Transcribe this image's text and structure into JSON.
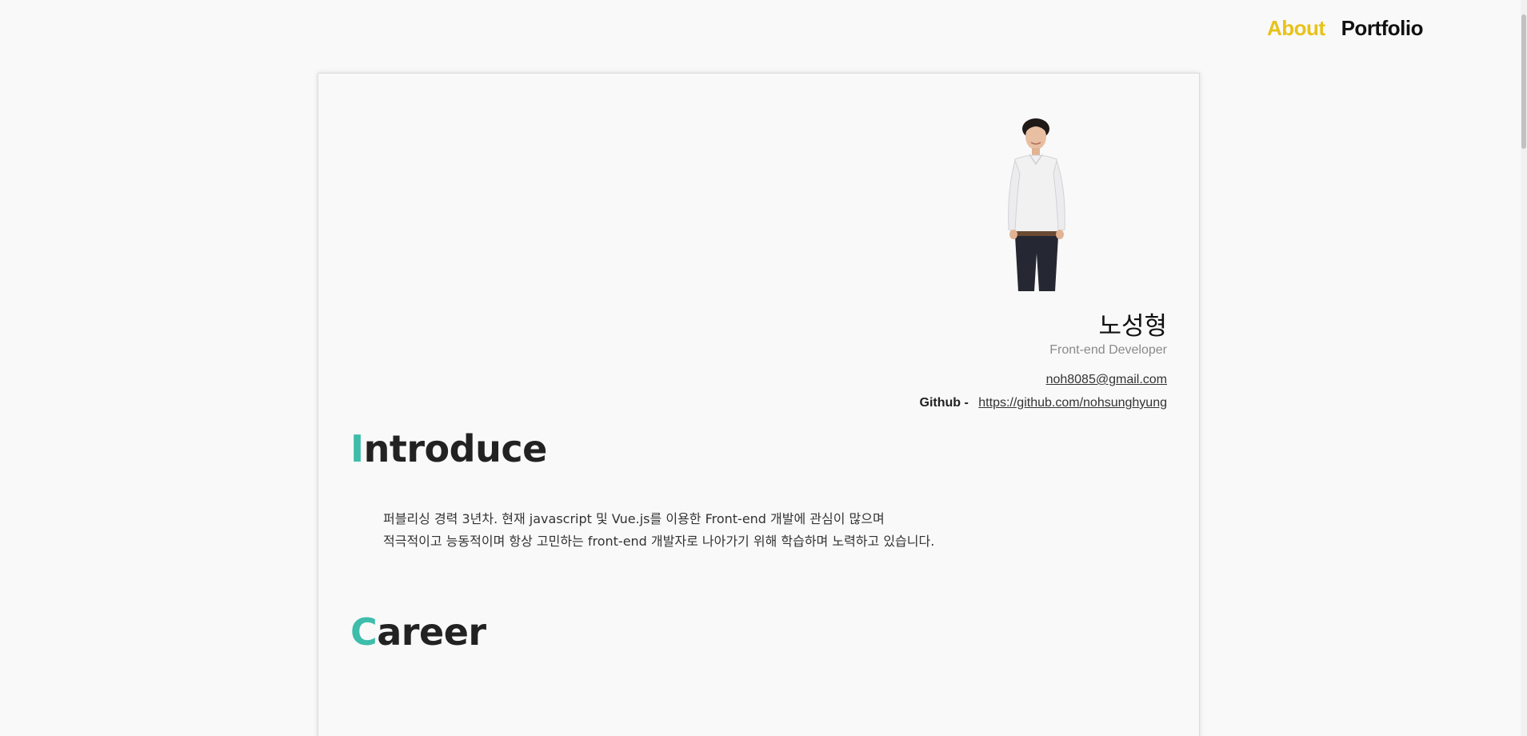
{
  "nav": {
    "about_label": "About",
    "portfolio_label": "Portfolio",
    "active_color": "#e8c21a"
  },
  "profile": {
    "name": "노성형",
    "role": "Front-end Developer",
    "email": "noh8085@gmail.com",
    "github_label": "Github -",
    "github_url": "https://github.com/nohsunghyung"
  },
  "sections": {
    "introduce": {
      "title_cap": "I",
      "title_rest": "ntroduce",
      "lines": [
        "퍼블리싱 경력 3년차. 현재 javascript 및 Vue.js를 이용한 Front-end 개발에 관심이 많으며",
        "적극적이고 능동적이며 항상 고민하는 front-end 개발자로 나아가기 위해 학습하며 노력하고 있습니다."
      ]
    },
    "career": {
      "title_cap": "C",
      "title_rest": "areer"
    }
  },
  "accent_color": "#3dbdaa",
  "icons": {
    "profile_photo": "person-photo"
  }
}
